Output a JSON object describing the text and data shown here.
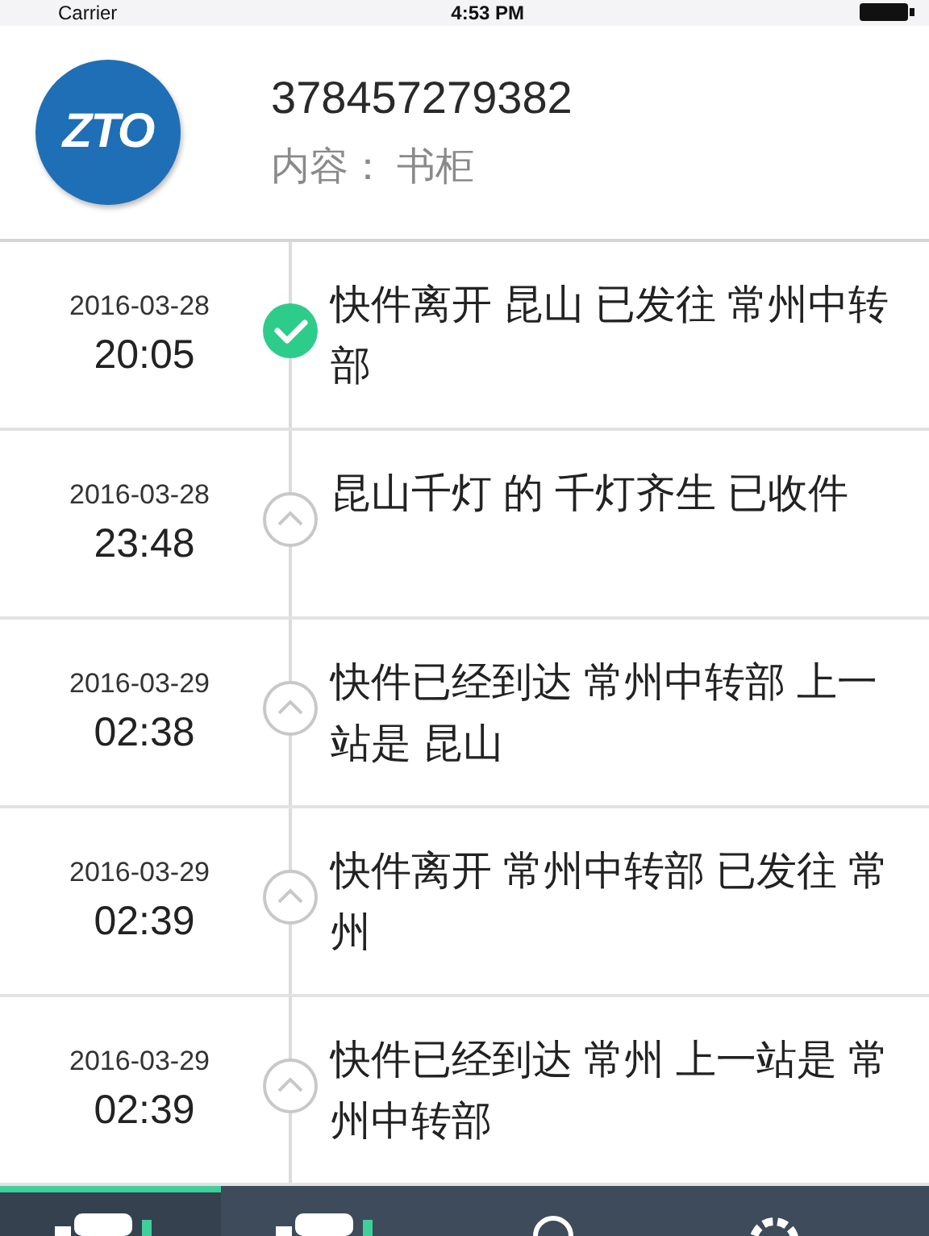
{
  "status_bar": {
    "carrier": "Carrier",
    "time": "4:53 PM"
  },
  "header": {
    "logo_text": "ZTO",
    "tracking_number": "378457279382",
    "content_label": "内容：",
    "content_value": "书柜"
  },
  "events": [
    {
      "date": "2016-03-28",
      "time": "20:05",
      "description": "快件离开 昆山 已发往 常州中转部",
      "completed": true
    },
    {
      "date": "2016-03-28",
      "time": "23:48",
      "description": "昆山千灯 的 千灯齐生 已收件",
      "completed": false
    },
    {
      "date": "2016-03-29",
      "time": "02:38",
      "description": "快件已经到达 常州中转部 上一站是 昆山",
      "completed": false
    },
    {
      "date": "2016-03-29",
      "time": "02:39",
      "description": "快件离开 常州中转部 已发往 常州",
      "completed": false
    },
    {
      "date": "2016-03-29",
      "time": "02:39",
      "description": "快件已经到达 常州 上一站是 常州中转部",
      "completed": false
    }
  ],
  "tab_bar": [
    {
      "kind": "truck",
      "selected": true
    },
    {
      "kind": "truck",
      "selected": false
    },
    {
      "kind": "person",
      "selected": false
    },
    {
      "kind": "settings",
      "selected": false
    }
  ]
}
